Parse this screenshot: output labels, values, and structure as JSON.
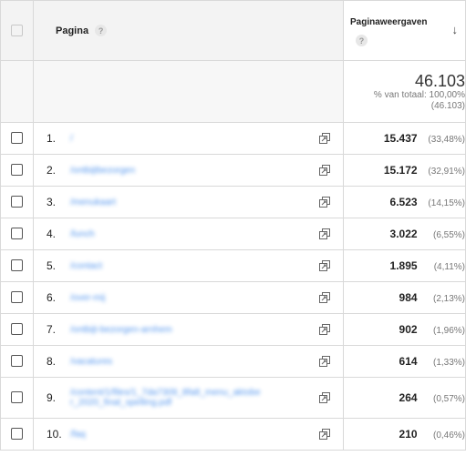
{
  "header": {
    "page_column": "Pagina",
    "views_column": "Paginaweergaven",
    "help_glyph": "?",
    "sort_glyph": "↓"
  },
  "totals": {
    "value": "46.103",
    "label": "% van totaal: 100,00%",
    "total_in_parens": "(46.103)"
  },
  "rows": [
    {
      "num": "1.",
      "path": "/",
      "views": "15.437",
      "pct": "(33,48%)"
    },
    {
      "num": "2.",
      "path": "/ontbijtbezorgen",
      "views": "15.172",
      "pct": "(32,91%)"
    },
    {
      "num": "3.",
      "path": "/menukaart",
      "views": "6.523",
      "pct": "(14,15%)"
    },
    {
      "num": "4.",
      "path": "/lunch",
      "views": "3.022",
      "pct": "(6,55%)"
    },
    {
      "num": "5.",
      "path": "/contact",
      "views": "1.895",
      "pct": "(4,11%)"
    },
    {
      "num": "6.",
      "path": "/over-mij",
      "views": "984",
      "pct": "(2,13%)"
    },
    {
      "num": "7.",
      "path": "/ontbijt-bezorgen-arnhem",
      "views": "902",
      "pct": "(1,96%)"
    },
    {
      "num": "8.",
      "path": "/vacatures",
      "views": "614",
      "pct": "(1,33%)"
    },
    {
      "num": "9.",
      "path": "/content/1/files/1_7da7309_8fa8_menu_aktobe r_2020_final_spelling.pdf",
      "views": "264",
      "pct": "(0,57%)"
    },
    {
      "num": "10.",
      "path": "/faq",
      "views": "210",
      "pct": "(0,46%)"
    }
  ],
  "icons": {
    "row_action": "open-in-new-window-icon"
  }
}
